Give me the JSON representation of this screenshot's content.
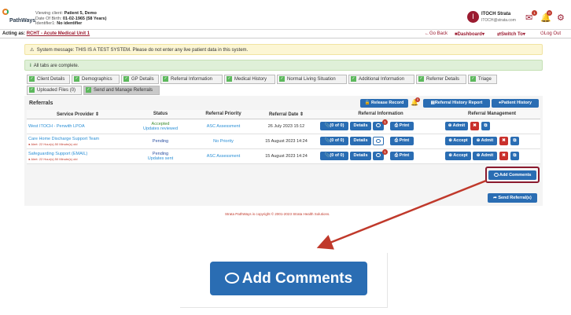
{
  "header": {
    "logo_top": "Strata Health, PathWays",
    "logo_name": "PathWays",
    "viewing_client_label": "Viewing client:",
    "viewing_client_value": "Patient 5, Demo",
    "dob_label": "Date Of Birth:",
    "dob_value": "01-02-1965 (58 Years)",
    "identifier_label": "Identifier1:",
    "identifier_value": "No identifier",
    "user_initials": "I",
    "user_name": "ITOCH Strata",
    "user_email": "ITOCH@strata.com",
    "mail_badge": "1",
    "bell_badge": "0"
  },
  "nav": {
    "acting_as_label": "Acting as:",
    "acting_as_value": "RCHT - Acute Medical Unit 1",
    "go_back": "←Go Back",
    "dashboard": "Dashboard▾",
    "switch_to": "Switch To▾",
    "logout": "Log Out"
  },
  "messages": {
    "system": "System message: THIS IS A TEST SYSTEM. Please do not enter any live patient data in this system.",
    "tabs_complete": "All tabs are complete."
  },
  "tabs": [
    {
      "label": "Client Details"
    },
    {
      "label": "Demographics"
    },
    {
      "label": "GP Details"
    },
    {
      "label": "Referral Information"
    },
    {
      "label": "Medical History"
    },
    {
      "label": "Normal Living Situation"
    },
    {
      "label": "Additional Information"
    },
    {
      "label": "Referrer Details"
    },
    {
      "label": "Triage"
    },
    {
      "label": "Uploaded Files (0)"
    },
    {
      "label": "Send and Manage Referrals"
    }
  ],
  "referrals": {
    "title": "Referrals",
    "release_record": "Release Record",
    "history_report": "Referral History Report",
    "patient_history": "Patient History",
    "bell_count": "0",
    "columns": [
      "Service Provider ⇕",
      "Status",
      "Referral Priority",
      "Referral Date ⇕",
      "Referral Information",
      "Referral Management"
    ],
    "rows": [
      {
        "provider": "West ITOCH - Penwith LPOA",
        "alert": "",
        "status": "Accepted",
        "status_sub": "Updates reviewed",
        "priority": "ASC Assessment",
        "date": "26 July 2023 15:12",
        "files": "(0 of 0)",
        "details": "Details",
        "badge": "1",
        "print": "Print",
        "accept": "",
        "admit": "Admit"
      },
      {
        "provider": "Care Home Discharge Support Team",
        "alert": "Alert: 22 Hour(s) 50 Minute(s) old",
        "status": "Pending",
        "status_sub": "",
        "priority": "No Priority",
        "date": "15 August 2023 14:24",
        "files": "(0 of 0)",
        "details": "Details",
        "badge": "",
        "print": "Print",
        "accept": "Accept",
        "admit": "Admit"
      },
      {
        "provider": "Safeguarding Support (EMAIL)",
        "alert": "Alert: 22 Hour(s) 50 Minute(s) old",
        "status": "Pending",
        "status_sub": "Updates sent",
        "priority": "ASC Assessment",
        "date": "15 August 2023 14:24",
        "files": "(0 of 0)",
        "details": "Details",
        "badge": "1",
        "print": "Print",
        "accept": "Accept",
        "admit": "Admit"
      }
    ],
    "add_comments": "Add Comments",
    "send_referrals": "Send Referral(s)"
  },
  "footer": {
    "copyright": "Strata PathWays is copyright © 2001-2023 Strata Health Solutions."
  },
  "zoom": {
    "label": "Add Comments"
  },
  "colors": {
    "primary_button": "#2a6db3",
    "brand_maroon": "#9b1b30",
    "highlight_border": "#8b1a2e",
    "danger": "#c9302c"
  }
}
